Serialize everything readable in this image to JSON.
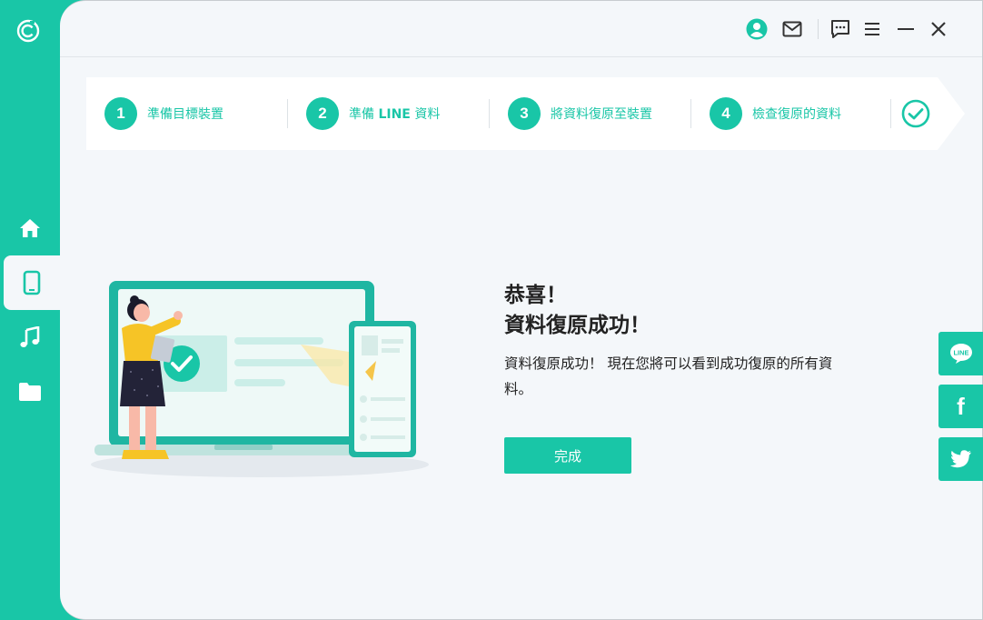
{
  "window": {
    "icons": [
      "app-logo-icon",
      "account-icon",
      "mail-icon",
      "feedback-icon",
      "menu-icon",
      "minimize-icon",
      "close-icon"
    ]
  },
  "sidebar": {
    "items": [
      {
        "name": "home",
        "icon": "home-icon"
      },
      {
        "name": "device",
        "icon": "phone-icon",
        "active": true
      },
      {
        "name": "music",
        "icon": "music-icon"
      },
      {
        "name": "files",
        "icon": "folder-icon"
      }
    ]
  },
  "steps": [
    {
      "num": "1",
      "label": "準備目標裝置"
    },
    {
      "num": "2",
      "label_pre": "準備 ",
      "label_bold": "LINE",
      "label_post": " 資料"
    },
    {
      "num": "3",
      "label": "將資料復原至裝置"
    },
    {
      "num": "4",
      "label": "檢查復原的資料"
    },
    {
      "icon": "check-circle-icon"
    }
  ],
  "result": {
    "title_line1": "恭喜！",
    "title_line2": "資料復原成功！",
    "description": "資料復原成功！ 現在您將可以看到成功復原的所有資料。",
    "done_label": "完成"
  },
  "social": {
    "line_label": "LINE",
    "facebook_label": "f"
  },
  "colors": {
    "accent": "#19c6a7",
    "background": "#f4f7fa",
    "text": "#222222"
  }
}
